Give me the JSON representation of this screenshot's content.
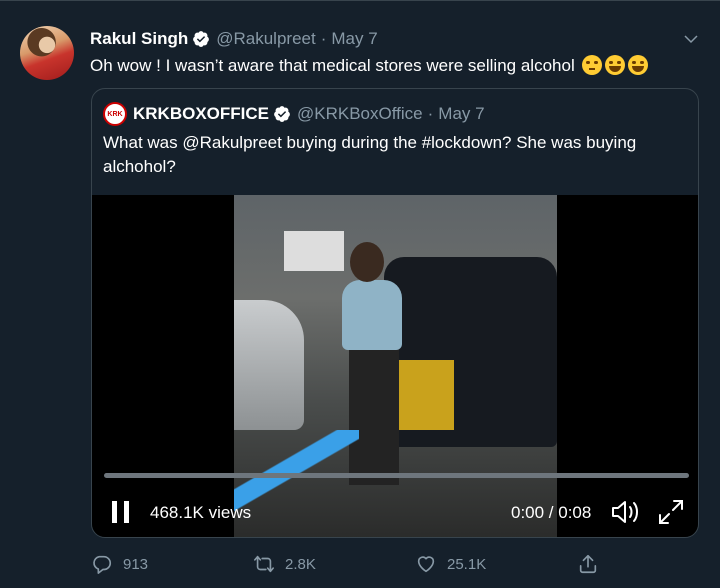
{
  "tweet": {
    "author_name": "Rakul Singh",
    "handle": "@Rakulpreet",
    "separator": "·",
    "date": "May 7",
    "text": "Oh wow ! I wasn’t aware that medical stores were selling alcohol",
    "emojis": [
      "thinking-face",
      "face-with-tears-of-joy",
      "face-with-tears-of-joy"
    ]
  },
  "quoted": {
    "logo_text": "KRK",
    "author_name": "KRKBOXOFFICE",
    "handle": "@KRKBoxOffice",
    "separator": "·",
    "date": "May 7",
    "text": "What was @Rakulpreet buying during the #lockdown? She was buying alchohol?",
    "video": {
      "views": "468.1K views",
      "time": "0:00 / 0:08",
      "progress": 0,
      "state": "playing"
    }
  },
  "actions": {
    "replies": "913",
    "retweets": "2.8K",
    "likes": "25.1K"
  },
  "colors": {
    "background": "#15202b",
    "border": "#38444d",
    "muted": "#8899a6",
    "verified": "#ffffff"
  }
}
